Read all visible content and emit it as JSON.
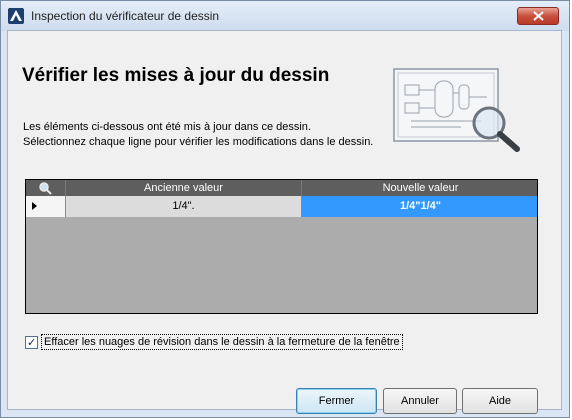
{
  "window": {
    "title": "Inspection du vérificateur de dessin"
  },
  "main": {
    "heading": "Vérifier les mises à jour du dessin",
    "description_line1": "Les éléments ci-dessous ont été mis à jour dans ce dessin.",
    "description_line2": "Sélectionnez chaque ligne pour vérifier les modifications dans le dessin."
  },
  "grid": {
    "columns": [
      "Ancienne valeur",
      "Nouvelle valeur"
    ],
    "rows": [
      {
        "old_value": "1/4\".",
        "new_value": "1/4\"1/4\""
      }
    ]
  },
  "options": {
    "clear_clouds_label": "Effacer les nuages de révision dans le dessin à la fermeture de la fenêtre",
    "clear_clouds_checked": true
  },
  "buttons": {
    "close": "Fermer",
    "cancel": "Annuler",
    "help": "Aide"
  },
  "colors": {
    "selected_cell": "#3399ff",
    "grid_header": "#5e5e5e",
    "close_button": "#c9503e"
  }
}
